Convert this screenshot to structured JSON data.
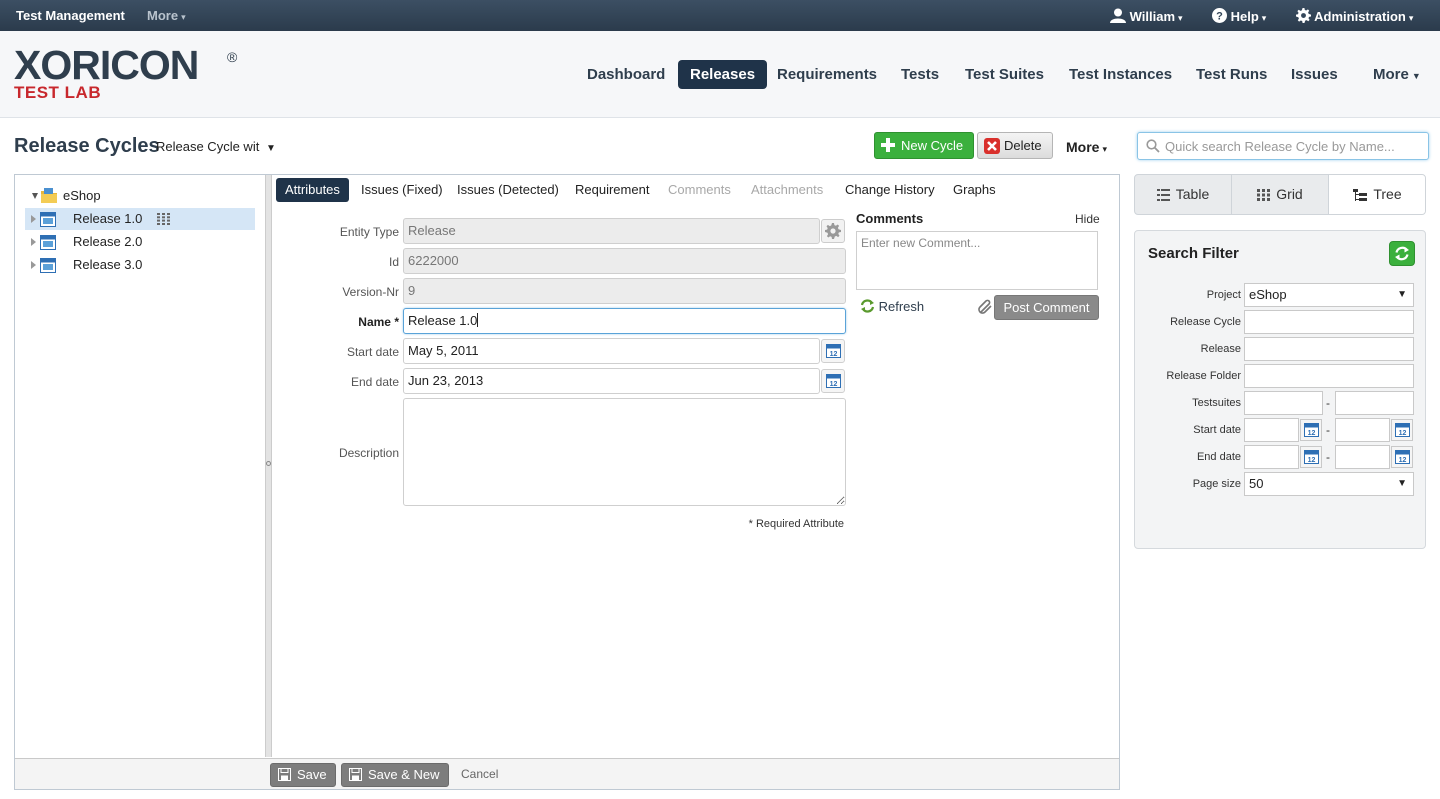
{
  "topbar": {
    "app_name": "Test Management",
    "more": "More",
    "user": "William",
    "help": "Help",
    "admin": "Administration"
  },
  "logo": {
    "main": "XORICON",
    "reg": "®",
    "sub": "TEST LAB"
  },
  "nav": {
    "dashboard": "Dashboard",
    "releases": "Releases",
    "requirements": "Requirements",
    "tests": "Tests",
    "test_suites": "Test Suites",
    "test_instances": "Test Instances",
    "test_runs": "Test Runs",
    "issues": "Issues",
    "more": "More"
  },
  "toolbar": {
    "title": "Release Cycles",
    "cycle_select": "Release Cycle wit",
    "new_cycle": "New Cycle",
    "delete": "Delete",
    "more": "More",
    "search_placeholder": "Quick search Release Cycle by Name..."
  },
  "tree": {
    "root": "eShop",
    "items": [
      "Release 1.0",
      "Release 2.0",
      "Release 3.0"
    ]
  },
  "tabs": {
    "attributes": "Attributes",
    "issues_fixed": "Issues (Fixed)",
    "issues_detected": "Issues (Detected)",
    "requirement": "Requirement",
    "comments": "Comments",
    "attachments": "Attachments",
    "change_history": "Change History",
    "graphs": "Graphs"
  },
  "form": {
    "entity_type_label": "Entity Type",
    "entity_type": "Release",
    "id_label": "Id",
    "id": "6222000",
    "version_label": "Version-Nr",
    "version": "9",
    "name_label": "Name",
    "required_star": "*",
    "name": "Release 1.0",
    "start_label": "Start date",
    "start_date": "May 5, 2011",
    "end_label": "End date",
    "end_date": "Jun 23, 2013",
    "description_label": "Description",
    "description": "",
    "required_note": "* Required Attribute",
    "cal_day": "12"
  },
  "comments": {
    "title": "Comments",
    "hide": "Hide",
    "placeholder": "Enter new Comment...",
    "refresh": "Refresh",
    "post": "Post Comment"
  },
  "bottom": {
    "save": "Save",
    "save_new": "Save & New",
    "cancel": "Cancel"
  },
  "view_tabs": {
    "table": "Table",
    "grid": "Grid",
    "tree": "Tree"
  },
  "filter": {
    "title": "Search Filter",
    "project_label": "Project",
    "project": "eShop",
    "release_cycle_label": "Release Cycle",
    "release_label": "Release",
    "release_folder_label": "Release Folder",
    "testsuites_label": "Testsuites",
    "start_label": "Start date",
    "end_label": "End date",
    "page_size_label": "Page size",
    "page_size": "50",
    "range_sep": "-"
  },
  "colors": {
    "nav_active": "#1f3349",
    "green": "#3bb03d",
    "red": "#c8282d",
    "selection": "#d5e6f6"
  }
}
